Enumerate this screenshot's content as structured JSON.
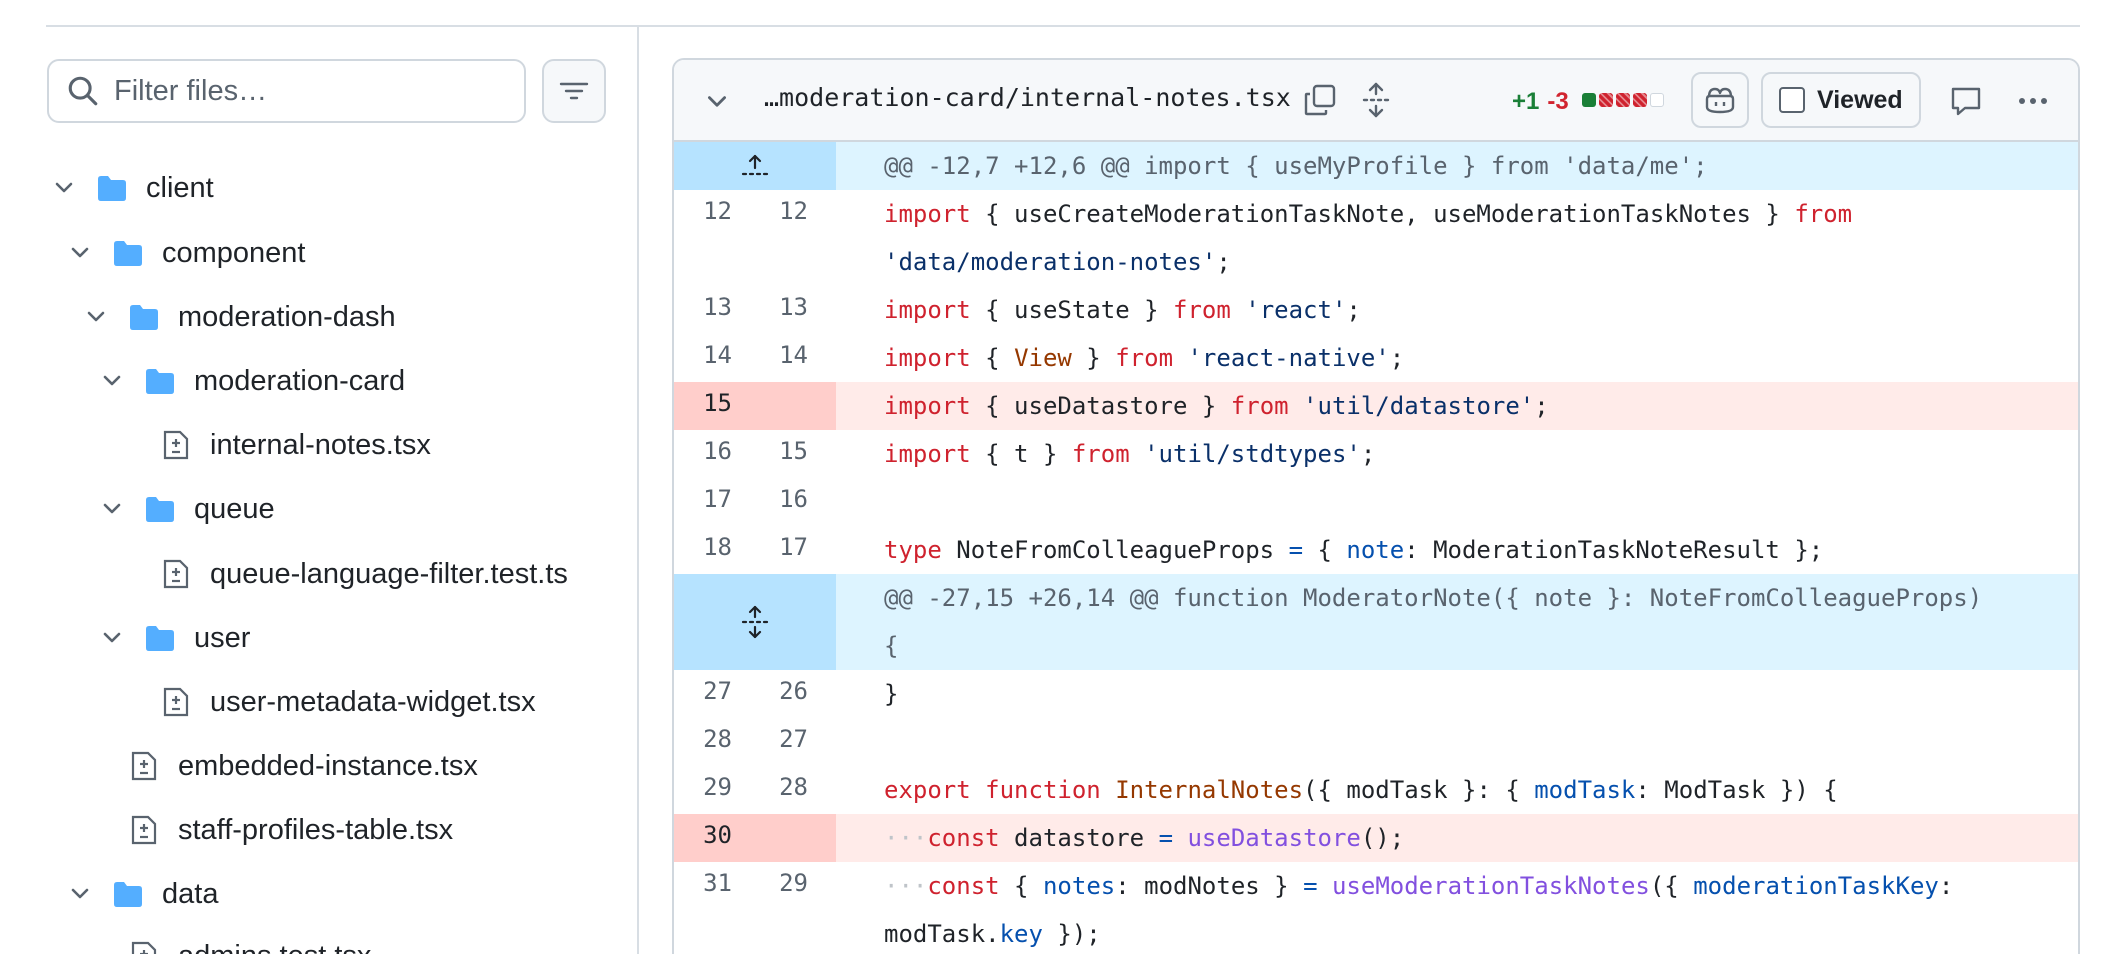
{
  "sidebar": {
    "filter_placeholder": "Filter files…",
    "tree": [
      {
        "type": "folder",
        "name": "client"
      },
      {
        "type": "folder",
        "name": "component"
      },
      {
        "type": "folder",
        "name": "moderation-dash"
      },
      {
        "type": "folder",
        "name": "moderation-card"
      },
      {
        "type": "file",
        "name": "internal-notes.tsx"
      },
      {
        "type": "folder",
        "name": "queue"
      },
      {
        "type": "file",
        "name": "queue-language-filter.test.ts"
      },
      {
        "type": "folder",
        "name": "user"
      },
      {
        "type": "file",
        "name": "user-metadata-widget.tsx"
      },
      {
        "type": "file",
        "name": "embedded-instance.tsx"
      },
      {
        "type": "file",
        "name": "staff-profiles-table.tsx"
      },
      {
        "type": "folder",
        "name": "data"
      },
      {
        "type": "file",
        "name": "admins.test.tsx"
      }
    ]
  },
  "diff": {
    "file_path": "…moderation-card/internal-notes.tsx",
    "additions": "+1",
    "deletions": "-3",
    "viewed_label": "Viewed",
    "stat_squares": [
      "add",
      "del",
      "del",
      "del",
      "neutral"
    ],
    "hunk1": "@@ -12,7 +12,6 @@ import { useMyProfile } from 'data/me';",
    "hunk2_line1": "@@ -27,15 +26,14 @@ function ModeratorNote({ note }: NoteFromColleagueProps)",
    "hunk2_line2": "{",
    "lines": [
      {
        "old": "12",
        "new": "12"
      },
      {
        "old": "13",
        "new": "13"
      },
      {
        "old": "14",
        "new": "14"
      },
      {
        "old": "15",
        "new": ""
      },
      {
        "old": "16",
        "new": "15"
      },
      {
        "old": "17",
        "new": "16"
      },
      {
        "old": "18",
        "new": "17"
      },
      {
        "old": "27",
        "new": "26"
      },
      {
        "old": "28",
        "new": "27"
      },
      {
        "old": "29",
        "new": "28"
      },
      {
        "old": "30",
        "new": ""
      },
      {
        "old": "31",
        "new": "29"
      }
    ]
  },
  "colors": {
    "deletion_bg": "#ffebe9",
    "deletion_gutter": "#ffcecb",
    "hunk_bg": "#ddf4ff",
    "hunk_gutter": "#b6e3ff",
    "addition_text": "#1a7f37",
    "deletion_text": "#d1242f",
    "folder_icon": "#54aeff"
  }
}
